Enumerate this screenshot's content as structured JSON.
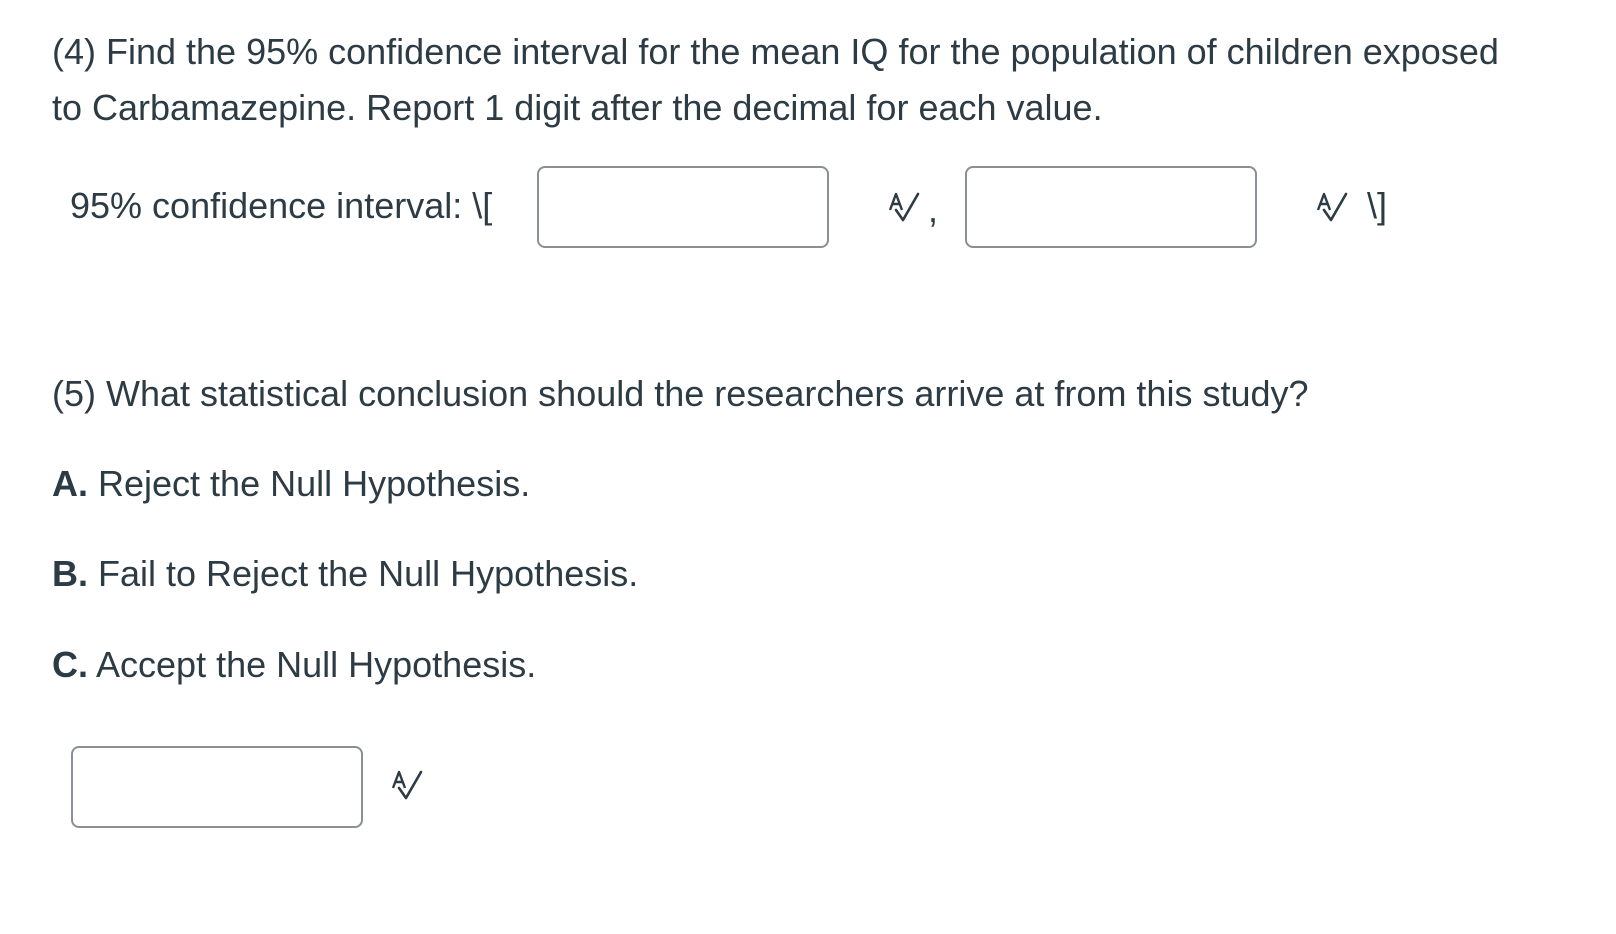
{
  "question4": {
    "text": "(4) Find the 95% confidence interval for the mean IQ for the population of children exposed to Carbamazepine.  Report 1 digit after the decimal for each value."
  },
  "confidence_interval": {
    "label": "95% confidence interval: \\[",
    "separator": ",",
    "close_bracket": "\\]",
    "lower_value": "",
    "upper_value": ""
  },
  "question5": {
    "text": "(5) What statistical conclusion should the researchers arrive at from this study?",
    "options": [
      {
        "letter": "A.",
        "text": " Reject the Null Hypothesis."
      },
      {
        "letter": "B.",
        "text": " Fail to Reject the Null Hypothesis."
      },
      {
        "letter": "C.",
        "text": " Accept the Null Hypothesis."
      }
    ],
    "answer_value": ""
  },
  "icons": {
    "spell_check": "spell-check-icon"
  }
}
